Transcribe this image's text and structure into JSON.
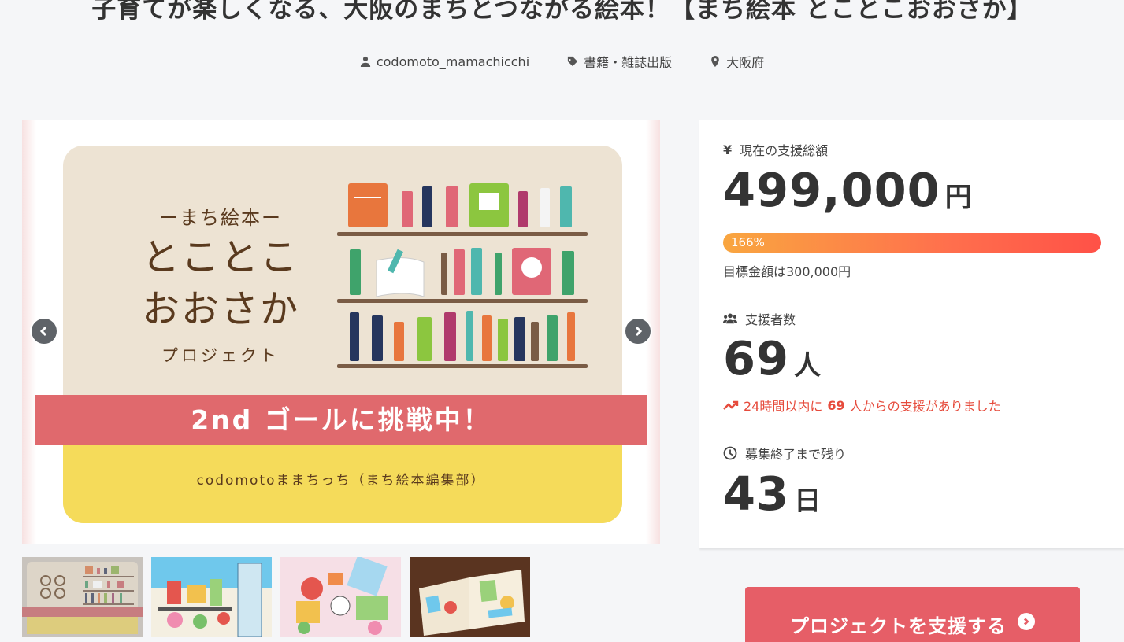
{
  "project": {
    "title": "子育てが楽しくなる、大阪のまちとつながる絵本！【まち絵本 とことこおおさか】",
    "author": "codomoto_mamachicchi",
    "category": "書籍・雑誌出版",
    "location": "大阪府"
  },
  "hero": {
    "subtitle": "ーまち絵本ー",
    "title_line1": "とことこ",
    "title_line2": "おおさか",
    "project_word": "プロジェクト",
    "ribbon": "2nd ゴールに挑戦中！",
    "publisher": "codomotoままちっち（まち絵本編集部）"
  },
  "stats": {
    "total_label": "現在の支援総額",
    "total_value": "499,000",
    "total_unit": "円",
    "progress_text": "166%",
    "progress_fraction": 1.0,
    "goal_text": "目標金額は300,000円",
    "supporters_label": "支援者数",
    "supporters_value": "69",
    "supporters_unit": "人",
    "trend_prefix": "24時間以内に",
    "trend_count": "69",
    "trend_suffix": "人からの支援がありました",
    "remaining_label": "募集終了まで残り",
    "remaining_value": "43",
    "remaining_unit": "日"
  },
  "support_button": "プロジェクトを支援する",
  "icons": {
    "currency": "yen-icon",
    "author": "user-icon",
    "category": "tag-icon",
    "location": "map-pin-icon",
    "supporters": "users-icon",
    "trend": "trending-up-icon",
    "clock": "clock-icon"
  },
  "colors": {
    "accent": "#e65e67",
    "ribbon": "#e0696d",
    "progress_start": "#f9a640",
    "progress_end": "#ff5147",
    "trend": "#e64b3c"
  }
}
